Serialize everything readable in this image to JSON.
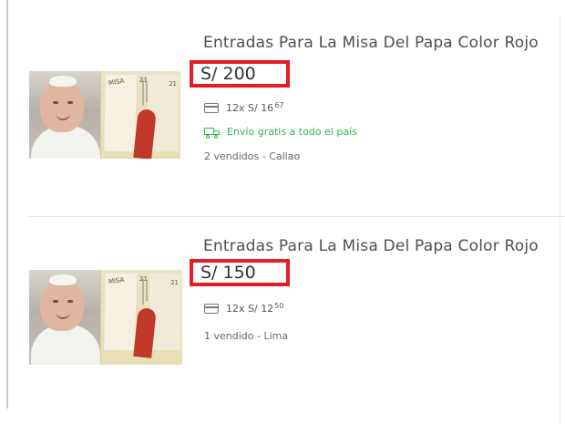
{
  "listings": [
    {
      "title": "Entradas Para La Misa Del Papa Color Rojo",
      "price": "S/ 200",
      "installments": {
        "prefix": "12x S/ 16",
        "cents": "67"
      },
      "shipping": "Envío gratis a todo el país",
      "sold": "2 vendidos - Callao",
      "image": {
        "poster_text": [
          "MISA",
          "21",
          "21"
        ]
      }
    },
    {
      "title": "Entradas Para La Misa Del Papa Color Rojo",
      "price": "S/ 150",
      "installments": {
        "prefix": "12x S/ 12",
        "cents": "50"
      },
      "sold": "1 vendido - Lima",
      "image": {
        "poster_text": [
          "MISA",
          "21",
          "21"
        ]
      }
    }
  ],
  "colors": {
    "price_highlight": "#e31c25",
    "shipping_green": "#32b74b",
    "title_gray": "#4f4f4f"
  },
  "icons": {
    "installments": "card-icon",
    "shipping": "truck-icon"
  }
}
